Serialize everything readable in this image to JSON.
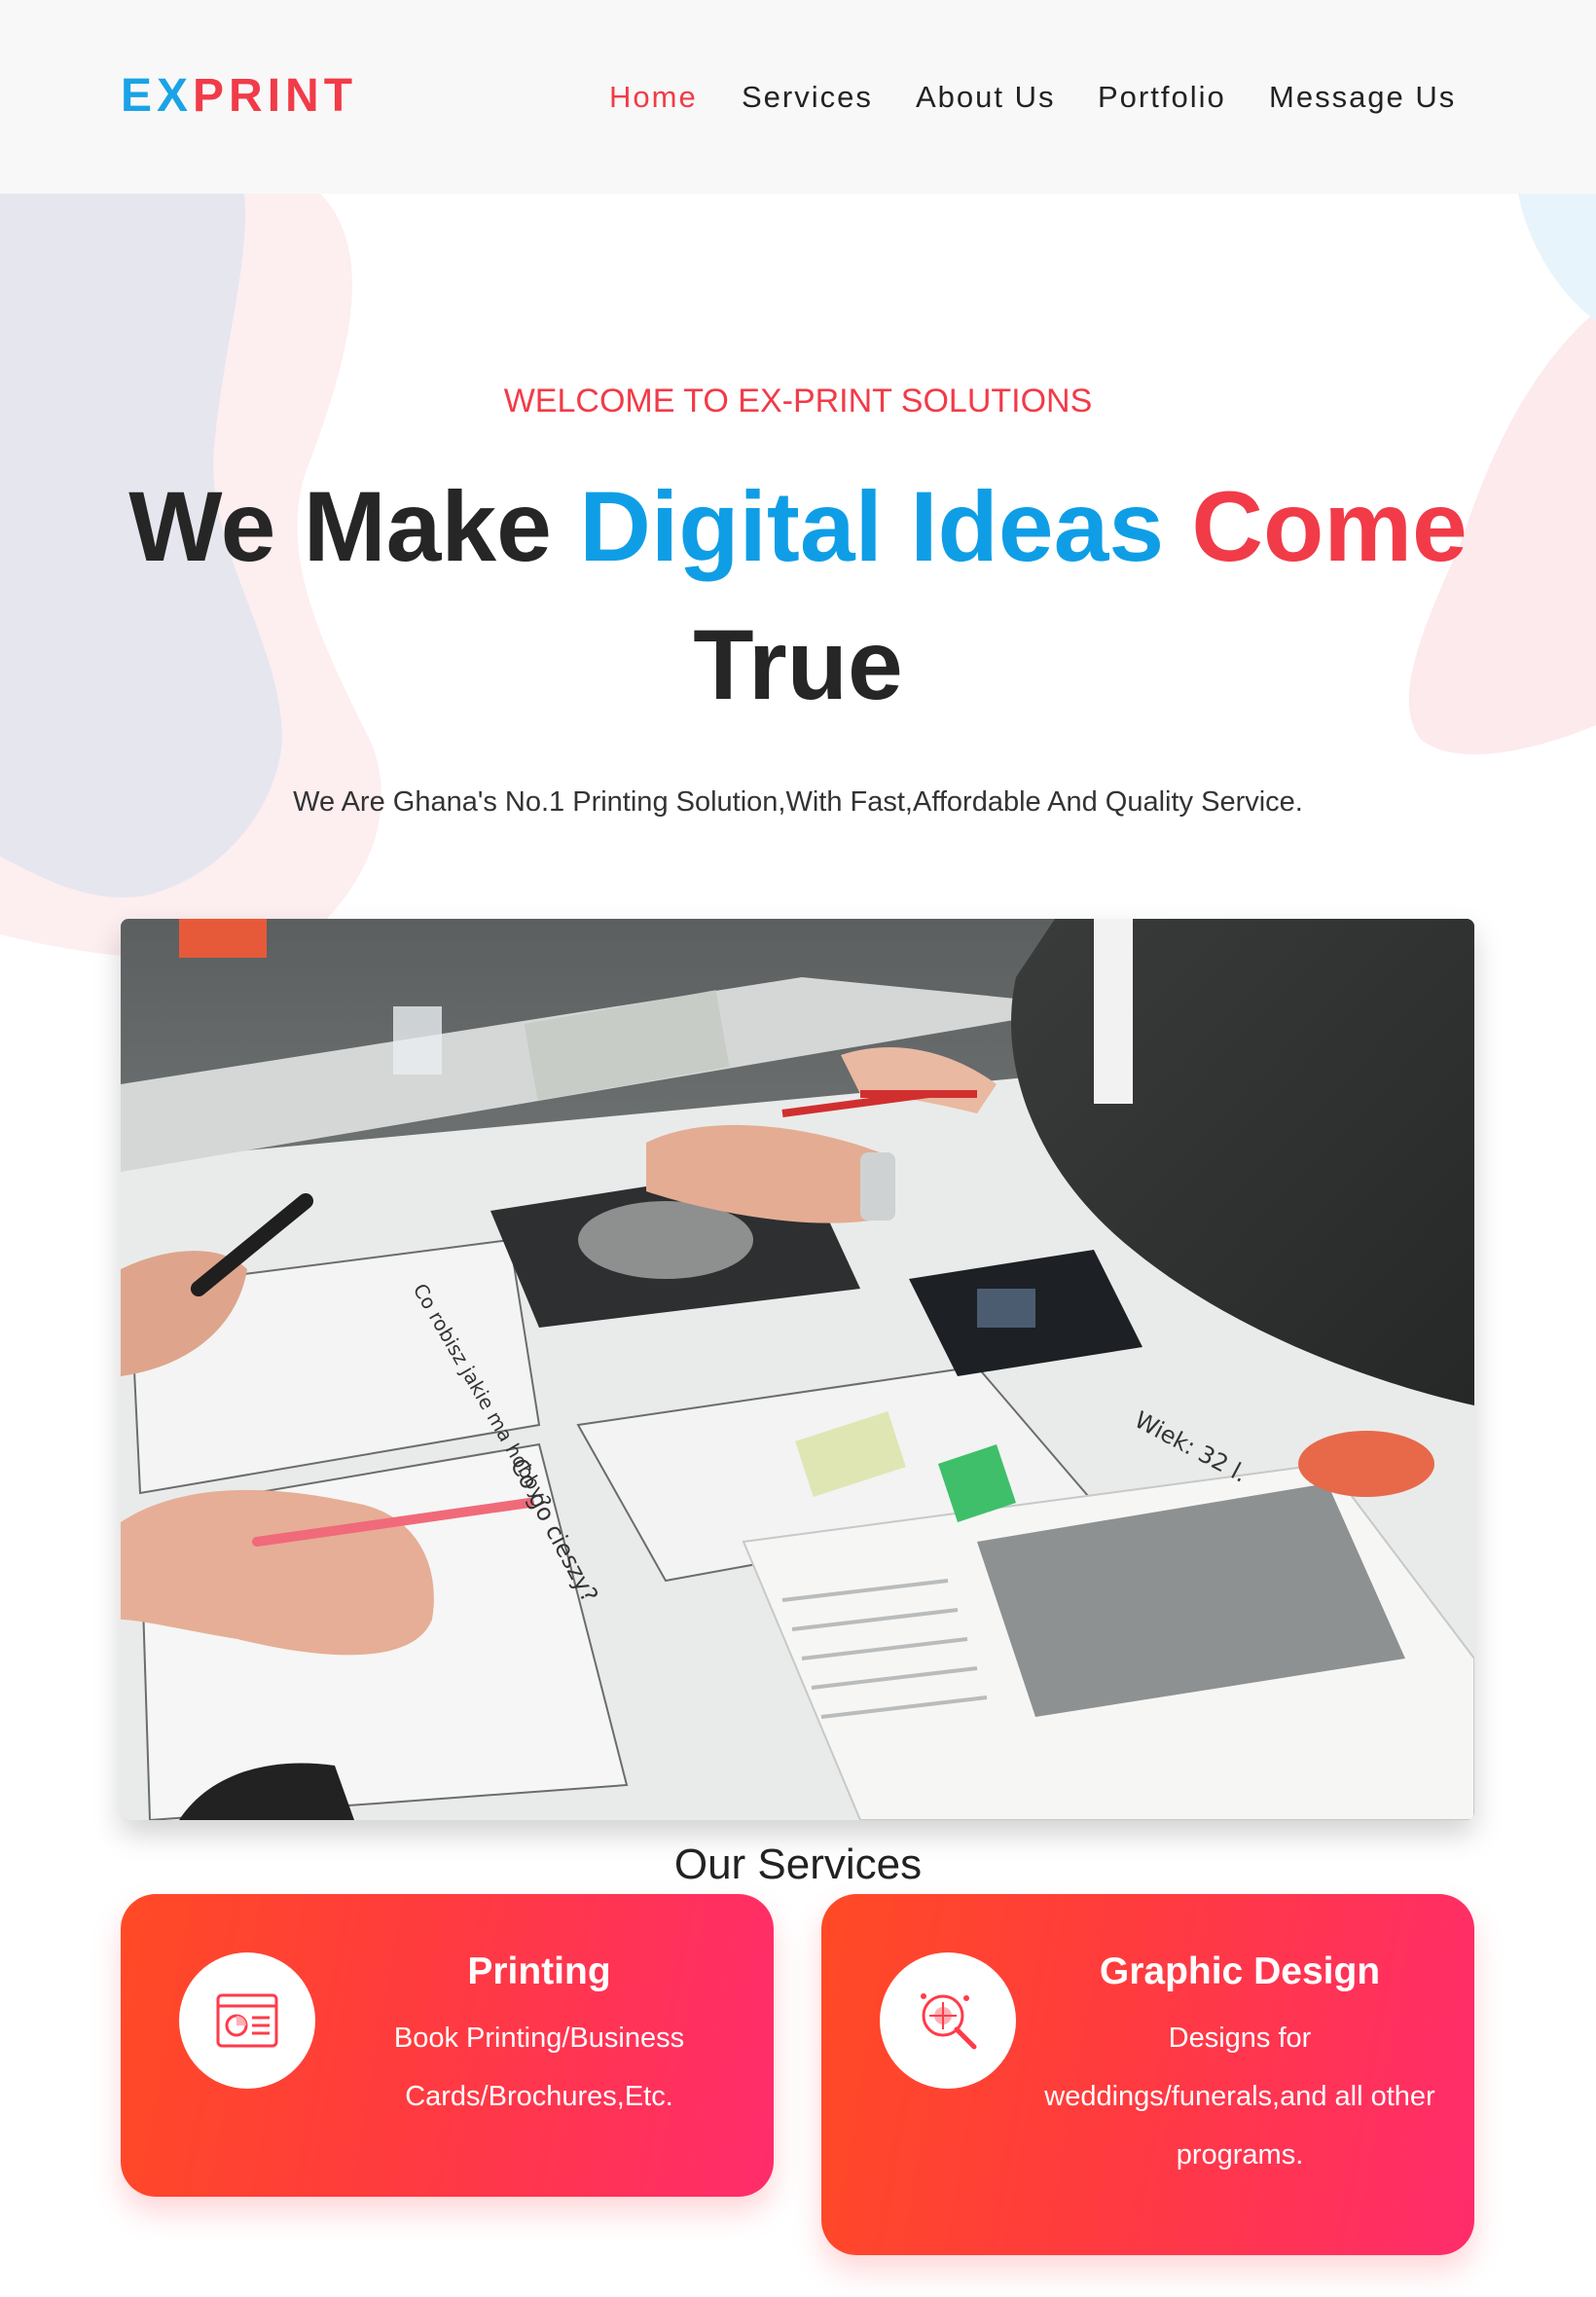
{
  "brand": {
    "prefix": "EX",
    "suffix": "PRINT",
    "colors": {
      "prefix": "#1aa3e6",
      "suffix": "#f23b48"
    }
  },
  "nav": {
    "items": [
      {
        "label": "Home",
        "active": true
      },
      {
        "label": "Services",
        "active": false
      },
      {
        "label": "About Us",
        "active": false
      },
      {
        "label": "Portfolio",
        "active": false
      },
      {
        "label": "Message Us",
        "active": false
      }
    ]
  },
  "hero": {
    "welcome": "WELCOME TO EX-PRINT SOLUTIONS",
    "headline": {
      "part1": "We Make ",
      "part2": "Digital Ideas",
      "part3": "Come",
      "part4": "True"
    },
    "subtext": "We Are Ghana's No.1 Printing Solution,With Fast,Affordable And Quality Service.",
    "photo_handwriting": [
      "Co robisz jakie ma hobby?",
      "Co go cieszy?",
      "Wiek: 32 l."
    ]
  },
  "services": {
    "title": "Our Services",
    "cards": [
      {
        "title": "Printing",
        "description": "Book Printing/Business Cards/Brochures,Etc.",
        "icon": "printed-document-icon"
      },
      {
        "title": "Graphic Design",
        "description": "Designs for weddings/funerals,and all other programs.",
        "icon": "design-search-icon"
      }
    ]
  },
  "colors": {
    "accent_red": "#f23b48",
    "accent_blue": "#0f9ee6",
    "header_bg": "#f8f8f8",
    "card_gradient_start": "#ff4a25",
    "card_gradient_end": "#ff2c6c"
  }
}
